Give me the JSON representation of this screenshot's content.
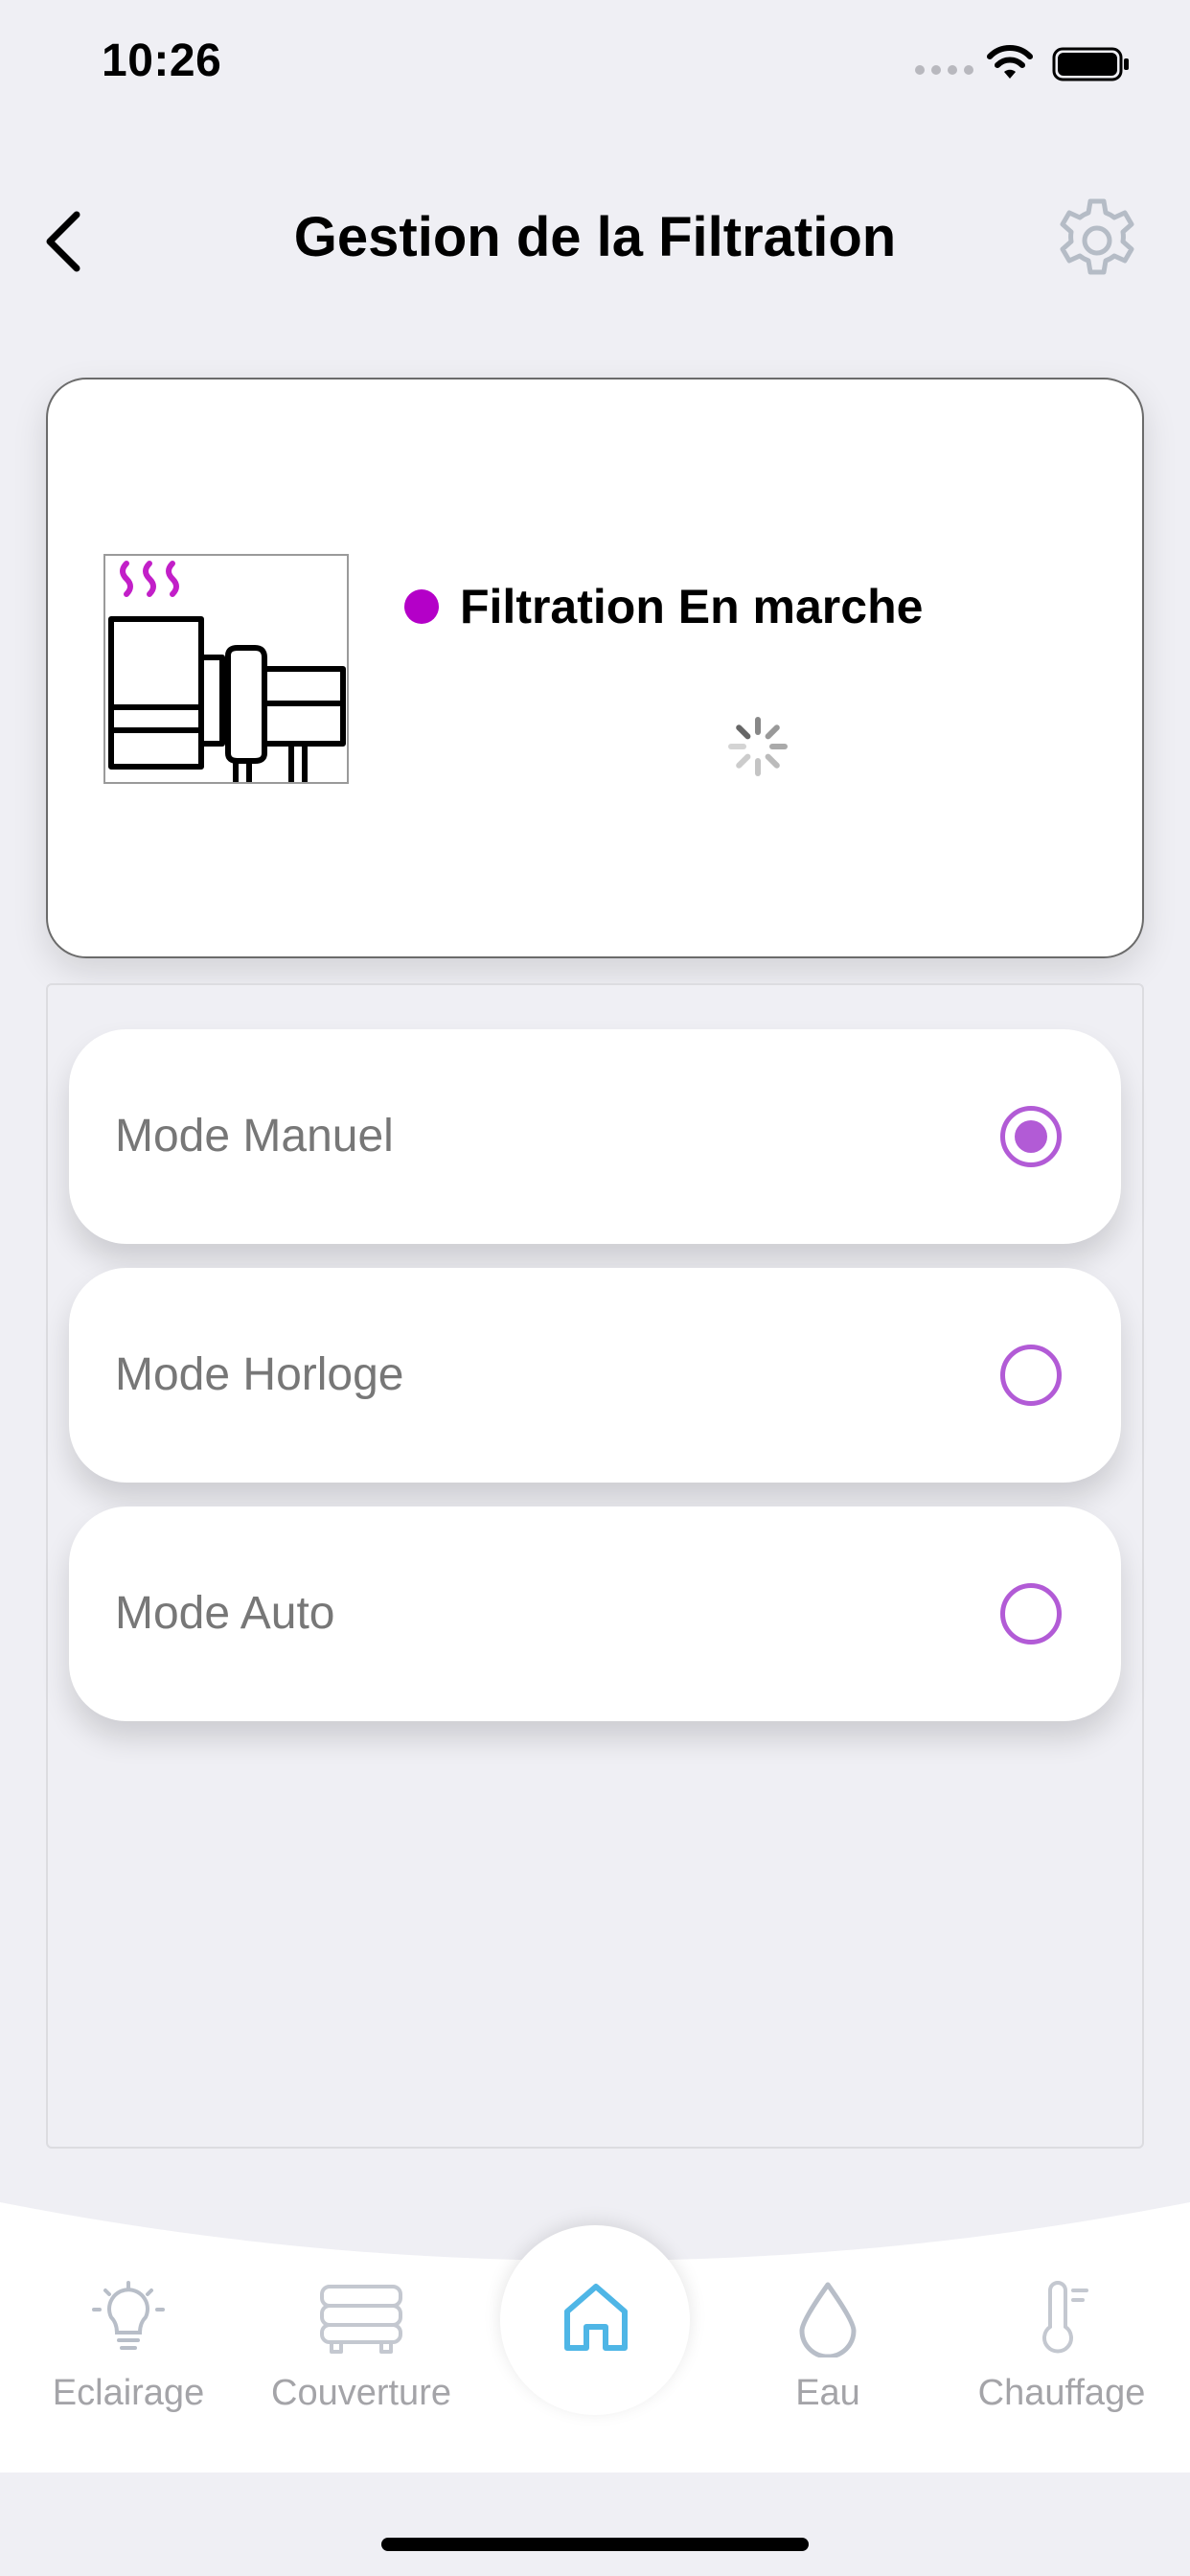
{
  "status_bar": {
    "time": "10:26"
  },
  "header": {
    "title": "Gestion de la Filtration"
  },
  "filtration": {
    "status_text": "Filtration En marche",
    "status_color": "#b400c8"
  },
  "modes": [
    {
      "label": "Mode Manuel",
      "selected": true
    },
    {
      "label": "Mode Horloge",
      "selected": false
    },
    {
      "label": "Mode Auto",
      "selected": false
    }
  ],
  "tabs": [
    {
      "label": "Eclairage",
      "icon": "lightbulb-icon"
    },
    {
      "label": "Couverture",
      "icon": "pool-cover-icon"
    },
    {
      "label": "",
      "icon": "home-icon"
    },
    {
      "label": "Eau",
      "icon": "water-drop-icon"
    },
    {
      "label": "Chauffage",
      "icon": "thermometer-icon"
    }
  ],
  "colors": {
    "accent_radio": "#b25bd6",
    "home_icon": "#4fb6e6",
    "inactive_tab": "#a4a4a8"
  }
}
